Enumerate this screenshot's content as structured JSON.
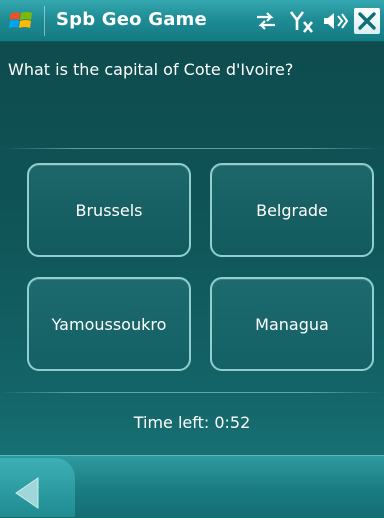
{
  "titlebar": {
    "app_name": "Spb Geo Game",
    "icons": [
      "windows-start-icon",
      "sync-icon",
      "signal-off-icon",
      "volume-icon",
      "close-icon"
    ]
  },
  "question": {
    "text": "What is the capital of Cote d'Ivoire?"
  },
  "answers": [
    {
      "label": "Brussels"
    },
    {
      "label": "Belgrade"
    },
    {
      "label": "Yamoussoukro"
    },
    {
      "label": "Managua"
    }
  ],
  "timer": {
    "text": "Time left: 0:52"
  },
  "bottom": {
    "icons": [
      "back-arrow-icon"
    ]
  },
  "colors": {
    "background": "#0f5356",
    "title_bar": "#1f8d96",
    "button_border": "#8fcfcf",
    "text": "#ffffff"
  }
}
